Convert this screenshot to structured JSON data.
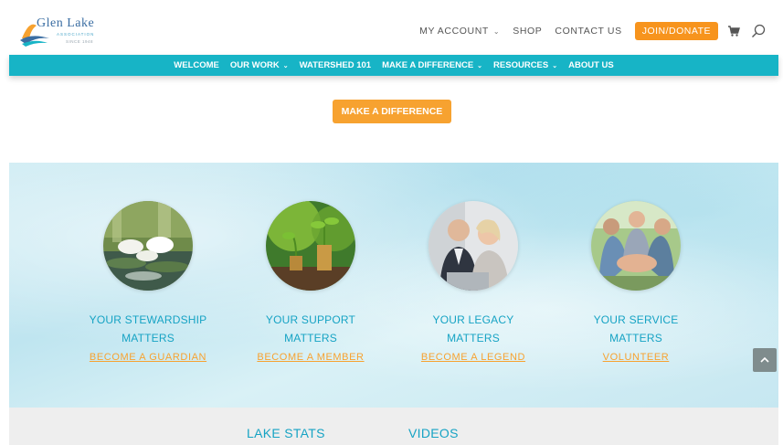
{
  "header": {
    "logo_name": "Glen Lake",
    "logo_subtitle": "ASSOCIATION",
    "logo_since": "SINCE 1948",
    "nav": [
      {
        "label": "MY ACCOUNT",
        "has_dropdown": true
      },
      {
        "label": "SHOP",
        "has_dropdown": false
      },
      {
        "label": "CONTACT US",
        "has_dropdown": false
      }
    ],
    "join_button": "JOIN/DONATE",
    "icons": {
      "cart": "cart-icon",
      "search": "search-icon"
    }
  },
  "main_nav": [
    {
      "label": "WELCOME",
      "has_dropdown": false
    },
    {
      "label": "OUR WORK",
      "has_dropdown": true
    },
    {
      "label": "WATERSHED 101",
      "has_dropdown": false
    },
    {
      "label": "MAKE A DIFFERENCE",
      "has_dropdown": true
    },
    {
      "label": "RESOURCES",
      "has_dropdown": true
    },
    {
      "label": "ABOUT US",
      "has_dropdown": false
    }
  ],
  "cta_button": "MAKE A DIFFERENCE",
  "cards": [
    {
      "title_line1": "YOUR STEWARDSHIP",
      "title_line2": "MATTERS",
      "link": "BECOME A GUARDIAN",
      "image": "water-lilies"
    },
    {
      "title_line1": "YOUR SUPPORT",
      "title_line2": "MATTERS",
      "link": "BECOME A MEMBER",
      "image": "coin-sprouts"
    },
    {
      "title_line1": "YOUR LEGACY",
      "title_line2": "MATTERS",
      "link": "BECOME A LEGEND",
      "image": "couple-laptop"
    },
    {
      "title_line1": "YOUR SERVICE",
      "title_line2": "MATTERS",
      "link": "VOLUNTEER",
      "image": "hands-together"
    }
  ],
  "footer": {
    "links": [
      "LAKE STATS",
      "VIDEOS"
    ]
  },
  "colors": {
    "teal": "#17b4c6",
    "orange": "#f7a230",
    "title_blue": "#16a3c4"
  }
}
